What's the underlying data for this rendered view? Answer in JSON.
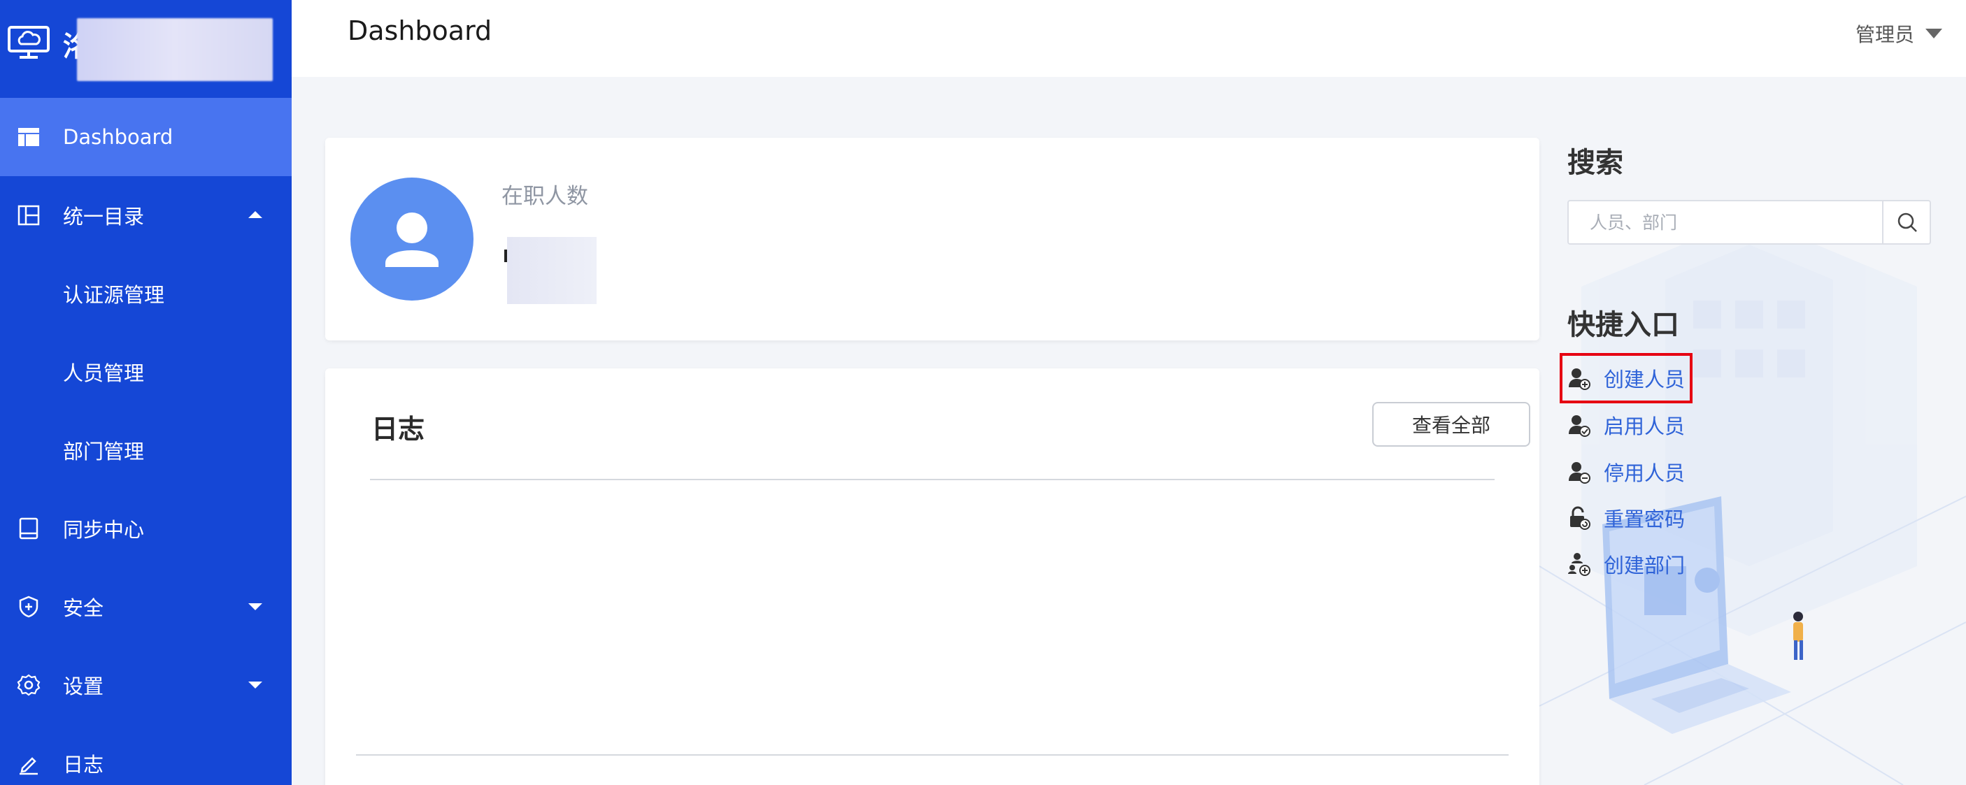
{
  "app": {
    "logo_char": "洺"
  },
  "header": {
    "title": "Dashboard",
    "user": "管理员"
  },
  "sidebar": {
    "items": [
      {
        "label": "Dashboard",
        "icon": "dashboard-icon",
        "active": true
      },
      {
        "label": "统一目录",
        "icon": "directory-icon",
        "expanded": true
      },
      {
        "label": "认证源管理",
        "sub": true
      },
      {
        "label": "人员管理",
        "sub": true
      },
      {
        "label": "部门管理",
        "sub": true
      },
      {
        "label": "同步中心",
        "icon": "sync-icon"
      },
      {
        "label": "安全",
        "icon": "shield-icon",
        "expanded": false
      },
      {
        "label": "设置",
        "icon": "gear-icon",
        "expanded": false
      },
      {
        "label": "日志",
        "icon": "edit-icon"
      }
    ]
  },
  "stats": {
    "label": "在职人数"
  },
  "log": {
    "title": "日志",
    "view_all": "查看全部"
  },
  "search": {
    "title": "搜索",
    "placeholder": "人员、部门"
  },
  "quick": {
    "title": "快捷入口",
    "items": [
      {
        "label": "创建人员",
        "icon": "user-add-icon",
        "highlighted": true
      },
      {
        "label": "启用人员",
        "icon": "user-check-icon"
      },
      {
        "label": "停用人员",
        "icon": "user-disable-icon"
      },
      {
        "label": "重置密码",
        "icon": "lock-reset-icon"
      },
      {
        "label": "创建部门",
        "icon": "org-icon"
      }
    ]
  },
  "colors": {
    "sidebar": "#1547d6",
    "sidebar_active": "#4874f0",
    "link": "#2f63d8",
    "highlight": "#e60012"
  }
}
